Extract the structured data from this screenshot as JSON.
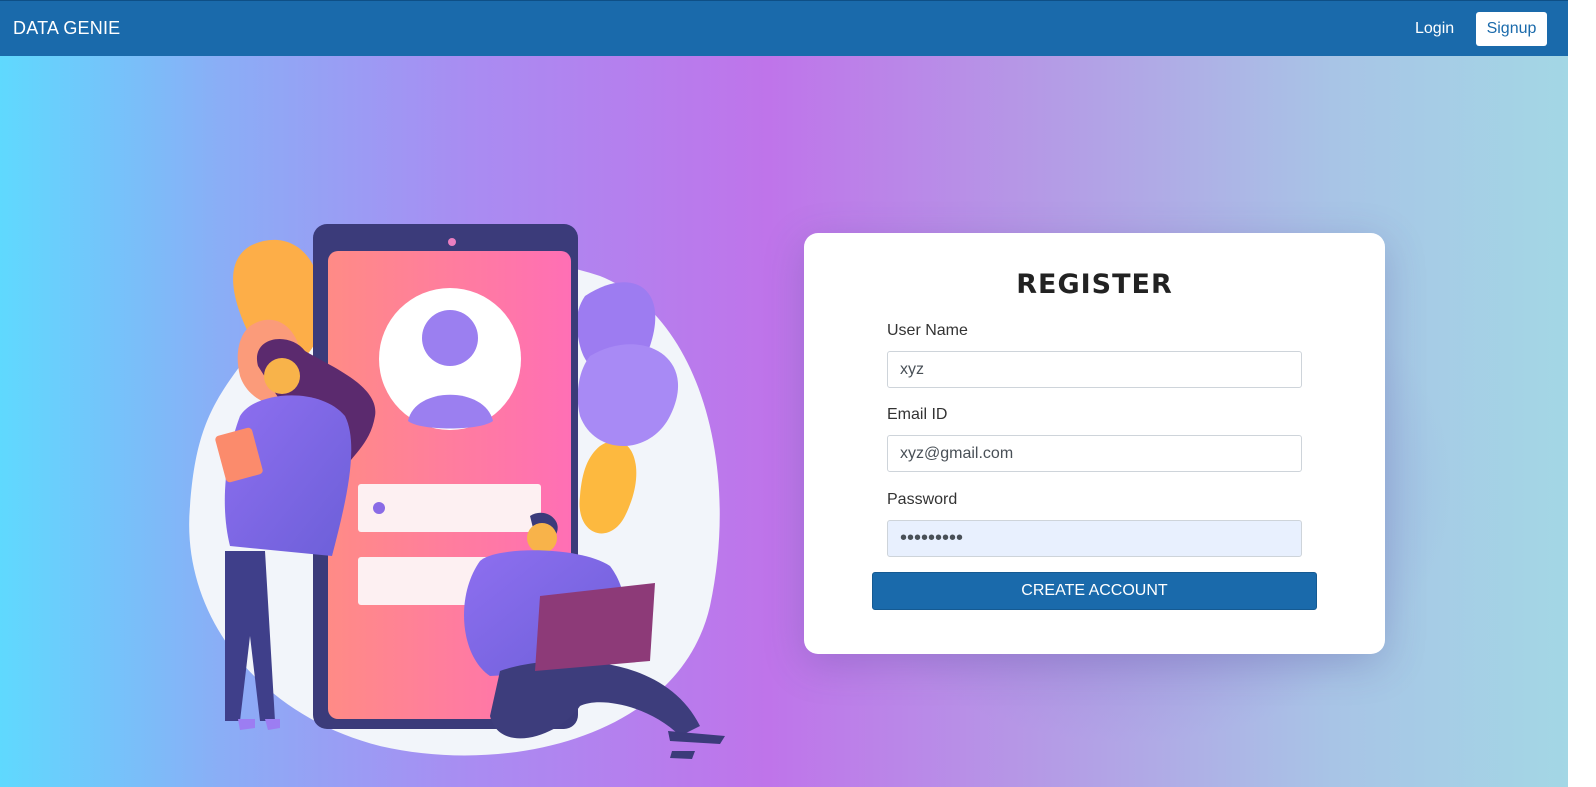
{
  "navbar": {
    "brand": "DATA GENIE",
    "login_label": "Login",
    "signup_label": "Signup"
  },
  "register": {
    "title": "REGISTER",
    "fields": [
      {
        "label": "User Name",
        "value": "xyz"
      },
      {
        "label": "Email ID",
        "value": "xyz@gmail.com"
      },
      {
        "label": "Password",
        "value": "•••••••••"
      }
    ],
    "submit_label": "CREATE ACCOUNT"
  },
  "colors": {
    "primary": "#1a6aab",
    "autofill_bg": "#e8f0fe"
  },
  "icons": {
    "illustration": "registration-illustration",
    "profile": "user-avatar-icon"
  }
}
